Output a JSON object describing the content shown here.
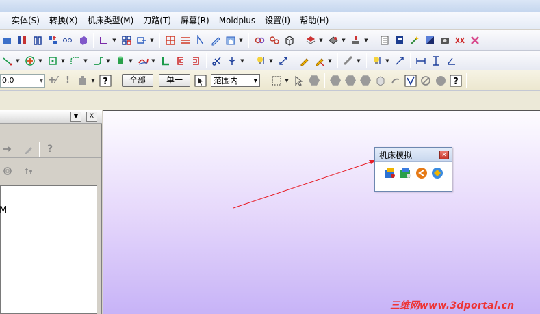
{
  "menu": [
    "实体(S)",
    "转换(X)",
    "机床类型(M)",
    "刀路(T)",
    "屏幕(R)",
    "Moldplus",
    "设置(I)",
    "帮助(H)"
  ],
  "toolbar3": {
    "value": "0.0",
    "all_button": "全部",
    "single_button": "单一",
    "range_select": "范围内"
  },
  "panel": {
    "tree_text": "M",
    "dropdown_glyph": "▼",
    "close_glyph": "X"
  },
  "floating_toolbar": {
    "title": "机床模拟",
    "close_glyph": "✕"
  },
  "watermark": "三维网www.3dportal.cn",
  "colors": {
    "canvas_top": "#fdfcff",
    "canvas_bottom": "#c7b3f7",
    "arrow": "#e8202a",
    "watermark": "#e33333"
  }
}
